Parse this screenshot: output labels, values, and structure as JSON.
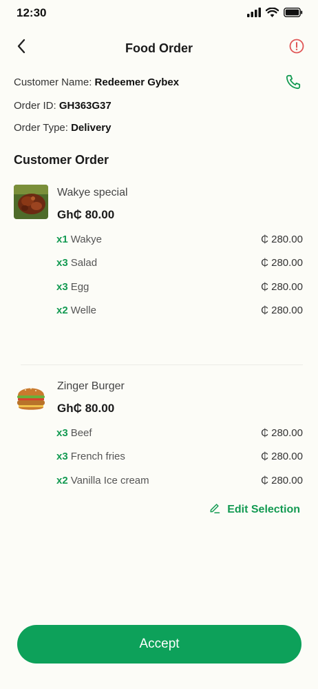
{
  "status_bar": {
    "time": "12:30"
  },
  "header": {
    "title": "Food Order"
  },
  "customer": {
    "name_label": "Customer Name: ",
    "name": "Redeemer Gybex",
    "order_id_label": "Order ID: ",
    "order_id": "GH363G37",
    "order_type_label": "Order Type: ",
    "order_type": "Delivery"
  },
  "section_title": "Customer Order",
  "orders": [
    {
      "name": "Wakye special",
      "price": "Gh₵ 80.00",
      "lines": [
        {
          "qty": "x1",
          "name": "Wakye",
          "amount": "₵ 280.00"
        },
        {
          "qty": "x3",
          "name": "Salad",
          "amount": "₵ 280.00"
        },
        {
          "qty": "x3",
          "name": "Egg",
          "amount": "₵ 280.00"
        },
        {
          "qty": "x2",
          "name": "Welle",
          "amount": "₵ 280.00"
        }
      ]
    },
    {
      "name": "Zinger Burger",
      "price": "Gh₵ 80.00",
      "lines": [
        {
          "qty": "x3",
          "name": "Beef",
          "amount": "₵ 280.00"
        },
        {
          "qty": "x3",
          "name": "French fries",
          "amount": "₵ 280.00"
        },
        {
          "qty": "x2",
          "name": "Vanilla Ice cream",
          "amount": "₵ 280.00"
        }
      ]
    }
  ],
  "edit_label": "Edit Selection",
  "accept_label": "Accept",
  "colors": {
    "accent": "#0DA15A",
    "alert": "#E05555",
    "background": "#FCFCF7"
  },
  "icons": [
    "signal-icon",
    "wifi-icon",
    "battery-icon",
    "back-arrow-icon",
    "alert-icon",
    "phone-icon",
    "pencil-icon"
  ]
}
